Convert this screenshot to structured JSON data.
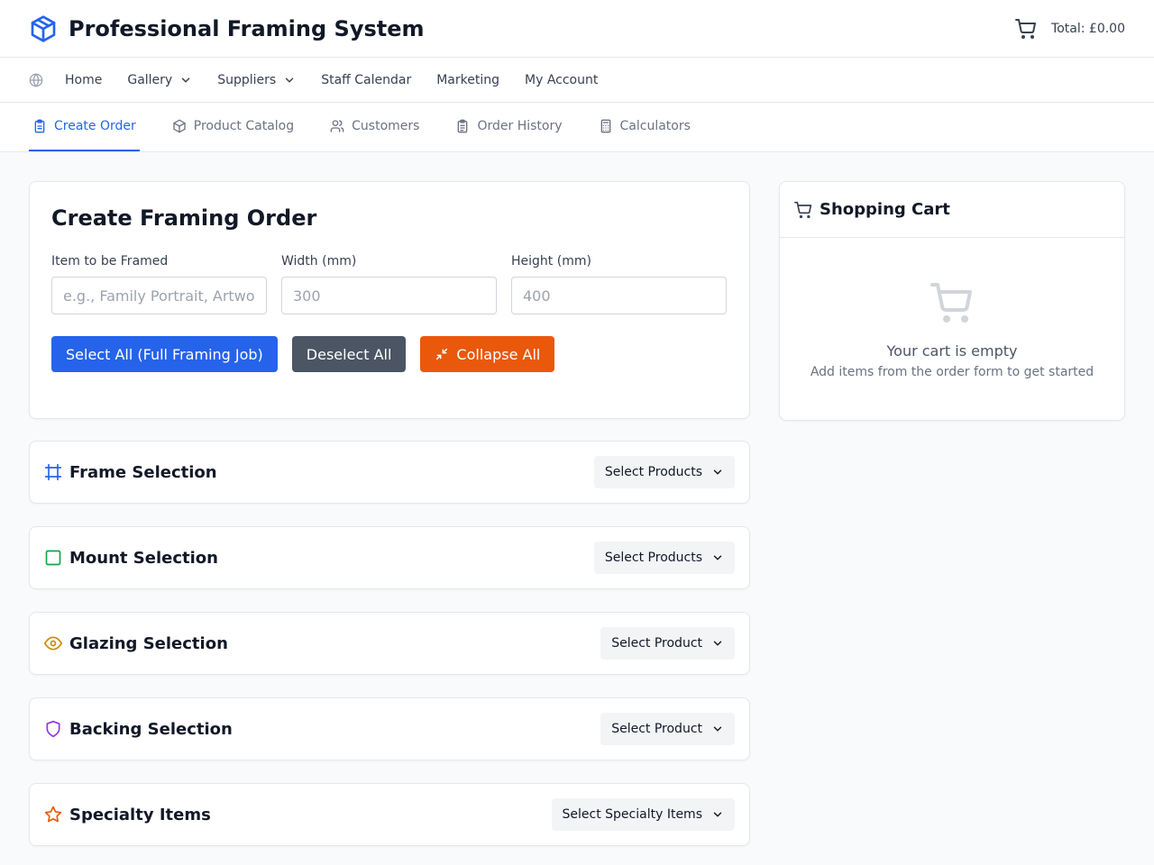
{
  "header": {
    "title": "Professional Framing System",
    "total": "Total: £0.00",
    "brand_icon": "cube-icon",
    "cart_icon": "cart-icon"
  },
  "nav": {
    "items": [
      {
        "label": "Home"
      },
      {
        "label": "Gallery"
      },
      {
        "label": "Suppliers"
      },
      {
        "label": "Staff Calendar"
      },
      {
        "label": "Marketing"
      },
      {
        "label": "My Account"
      }
    ]
  },
  "tabs": [
    {
      "label": "Create Order",
      "icon": "clipboard-icon",
      "active": true
    },
    {
      "label": "Product Catalog",
      "icon": "package-icon"
    },
    {
      "label": "Customers",
      "icon": "users-icon"
    },
    {
      "label": "Order History",
      "icon": "clipboard-list-icon"
    },
    {
      "label": "Calculators",
      "icon": "calculator-icon"
    }
  ],
  "order": {
    "title": "Create Framing Order",
    "item_label": "Item to be Framed",
    "item_placeholder": "e.g., Family Portrait, Artwork",
    "width_label": "Width (mm)",
    "width_placeholder": "300",
    "height_label": "Height (mm)",
    "height_placeholder": "400",
    "select_all": "Select All (Full Framing Job)",
    "deselect_all": "Deselect All",
    "collapse_all": "Collapse All"
  },
  "sections": [
    {
      "title": "Frame Selection",
      "button": "Select Products",
      "icon": "frame-icon",
      "color": "#2563eb"
    },
    {
      "title": "Mount Selection",
      "button": "Select Products",
      "icon": "square-icon",
      "color": "#16a34a"
    },
    {
      "title": "Glazing Selection",
      "button": "Select Product",
      "icon": "eye-icon",
      "color": "#ca8a04"
    },
    {
      "title": "Backing Selection",
      "button": "Select Product",
      "icon": "shield-icon",
      "color": "#9333ea"
    },
    {
      "title": "Specialty Items",
      "button": "Select Specialty Items",
      "icon": "star-icon",
      "color": "#ea580c"
    }
  ],
  "cart": {
    "title": "Shopping Cart",
    "empty_title": "Your cart is empty",
    "empty_sub": "Add items from the order form to get started"
  },
  "colors": {
    "accent": "#2563eb",
    "gray_button": "#4b5563",
    "orange_button": "#ea580c"
  }
}
